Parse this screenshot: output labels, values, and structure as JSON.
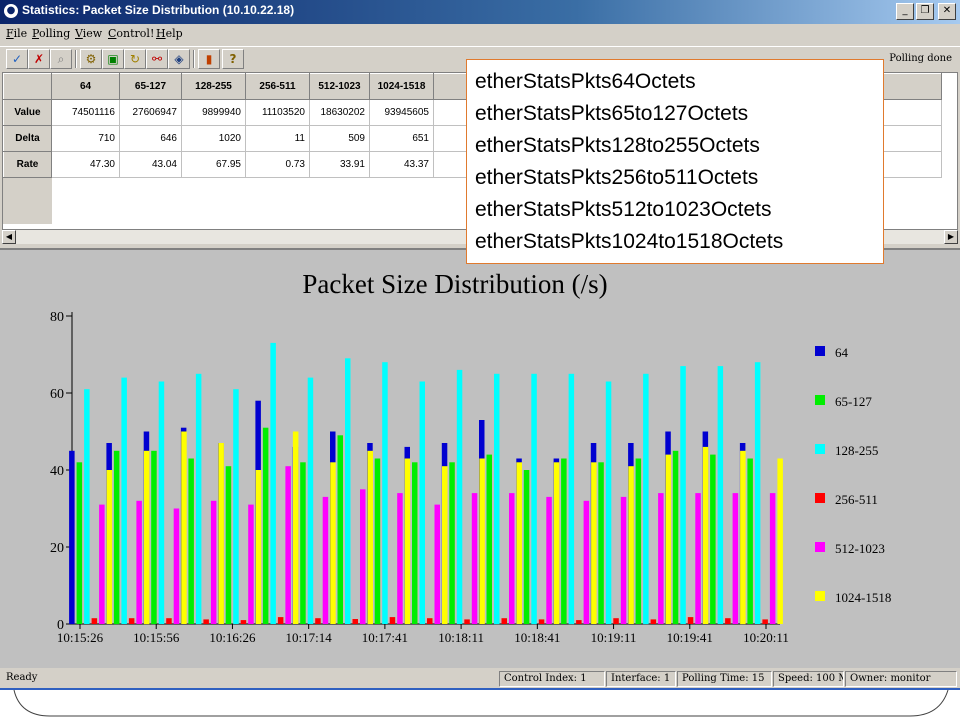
{
  "window": {
    "title": "Statistics: Packet Size Distribution (10.10.22.18)",
    "minimize_symbol": "_",
    "maximize_symbol": "❐",
    "close_symbol": "✕"
  },
  "menu": [
    "File",
    "Polling",
    "View",
    "Control!",
    "Help"
  ],
  "toolbar": {
    "buttons": [
      {
        "icon": "check-icon",
        "glyph": "✓"
      },
      {
        "icon": "cross-icon",
        "glyph": "✗"
      },
      {
        "icon": "magnifier-icon",
        "glyph": "⌕"
      },
      {
        "icon": "tool-icon",
        "glyph": "⚙"
      },
      {
        "icon": "bucket-icon",
        "glyph": "▣"
      },
      {
        "icon": "refresh-icon",
        "glyph": "↻"
      },
      {
        "icon": "link-icon",
        "glyph": "⚯"
      },
      {
        "icon": "graph-icon",
        "glyph": "◈"
      },
      {
        "icon": "bar-chart-icon",
        "glyph": "▮"
      },
      {
        "icon": "help-icon",
        "glyph": "?"
      }
    ],
    "status": "Polling done"
  },
  "table": {
    "columns": [
      "64",
      "65-127",
      "128-255",
      "256-511",
      "512-1023",
      "1024-1518"
    ],
    "rows": [
      {
        "label": "Value",
        "cells": [
          "74501116",
          "27606947",
          "9899940",
          "11103520",
          "18630202",
          "93945605"
        ]
      },
      {
        "label": "Delta",
        "cells": [
          "710",
          "646",
          "1020",
          "11",
          "509",
          "651"
        ]
      },
      {
        "label": "Rate",
        "cells": [
          "47.30",
          "43.04",
          "67.95",
          "0.73",
          "33.91",
          "43.37"
        ]
      }
    ],
    "scroll_left": "◀",
    "scroll_right": "▶"
  },
  "popup_lines": [
    "etherStatsPkts64Octets",
    "etherStatsPkts65to127Octets",
    "etherStatsPkts128to255Octets",
    "etherStatsPkts256to511Octets",
    "etherStatsPkts512to1023Octets",
    "etherStatsPkts1024to1518Octets"
  ],
  "chart_data": {
    "type": "bar",
    "title": "Packet Size Distribution (/s)",
    "xlabel": "",
    "ylabel": "",
    "ylim": [
      0,
      80
    ],
    "yticks": [
      0,
      20,
      40,
      60,
      80
    ],
    "x_tick_labels": [
      "10:15:26",
      "10:15:56",
      "10:16:26",
      "10:17:14",
      "10:17:41",
      "10:18:11",
      "10:18:41",
      "10:19:11",
      "10:19:41",
      "10:20:11"
    ],
    "legend_position": "right",
    "series": [
      {
        "name": "64",
        "color": "#0000d0",
        "values": [
          45,
          47,
          50,
          51,
          47,
          58,
          46,
          50,
          47,
          46,
          47,
          53,
          43,
          43,
          47,
          47,
          50,
          50,
          47
        ]
      },
      {
        "name": "65-127",
        "color": "#00ee00",
        "values": [
          42,
          45,
          45,
          43,
          41,
          51,
          42,
          49,
          43,
          42,
          42,
          44,
          40,
          43,
          42,
          43,
          45,
          44,
          43
        ]
      },
      {
        "name": "128-255",
        "color": "#00ffff",
        "values": [
          61,
          64,
          63,
          65,
          61,
          73,
          64,
          69,
          68,
          63,
          66,
          65,
          65,
          65,
          63,
          65,
          67,
          67,
          68
        ]
      },
      {
        "name": "256-511",
        "color": "#ff0000",
        "values": [
          1.5,
          1.5,
          1.5,
          1.2,
          1.0,
          1.8,
          1.5,
          1.3,
          1.8,
          1.5,
          1.2,
          1.5,
          1.2,
          1.0,
          1.5,
          1.2,
          1.8,
          1.5,
          1.2
        ]
      },
      {
        "name": "512-1023",
        "color": "#ff00ff",
        "values": [
          31,
          32,
          30,
          32,
          31,
          41,
          33,
          35,
          34,
          31,
          34,
          34,
          33,
          32,
          33,
          34,
          34,
          34,
          34
        ]
      },
      {
        "name": "1024-1518",
        "color": "#ffff00",
        "values": [
          40,
          45,
          50,
          47,
          40,
          50,
          42,
          45,
          43,
          41,
          43,
          42,
          42,
          42,
          41,
          44,
          46,
          45,
          43
        ]
      }
    ]
  },
  "statusbar": {
    "ready": "Ready",
    "control_index": "Control Index: 1",
    "interface": "Interface: 1",
    "polling_time": "Polling Time: 15",
    "speed": "Speed: 100 M",
    "owner": "Owner: monitor"
  }
}
